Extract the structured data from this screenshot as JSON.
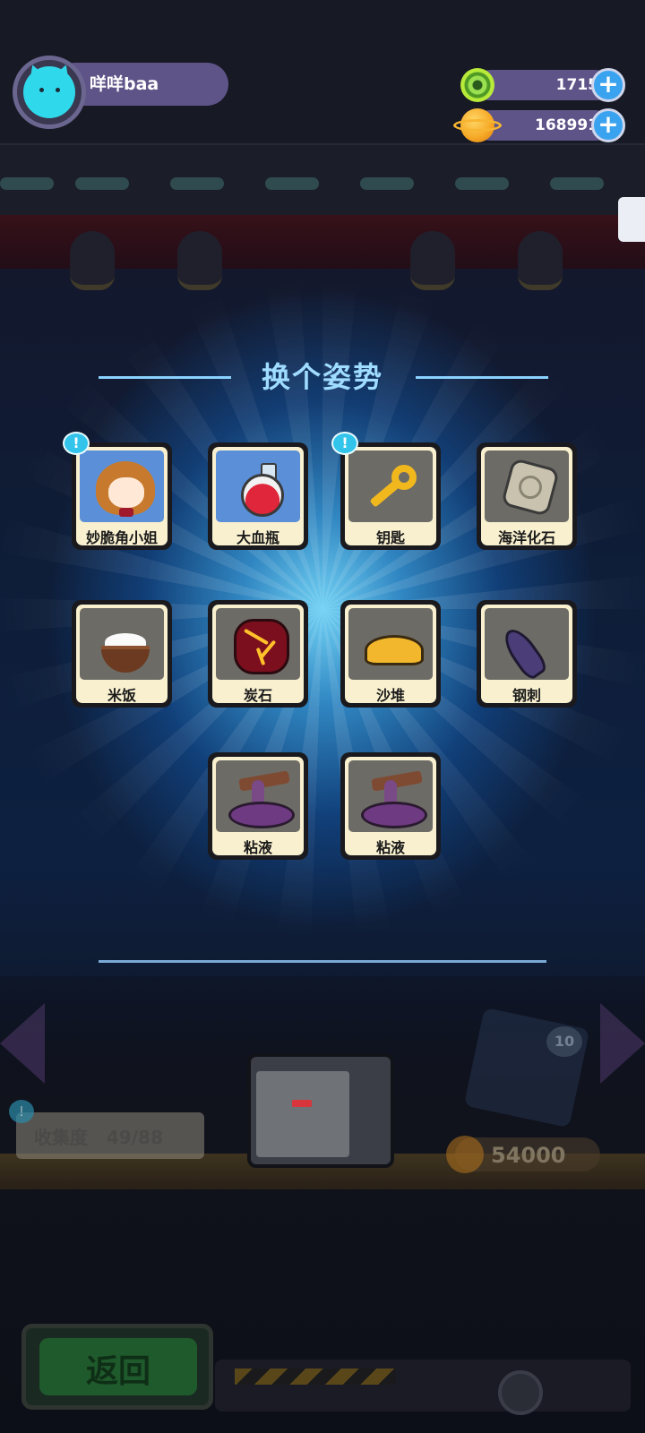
{
  "player": {
    "name": "咩咩baa",
    "avatar_icon": "cat-avatar-icon"
  },
  "currencies": [
    {
      "name": "gem",
      "value": "1715",
      "icon": "green-gem-icon"
    },
    {
      "name": "coin",
      "value": "168991",
      "icon": "planet-coin-icon"
    }
  ],
  "dialog": {
    "title": "换个姿势",
    "items": [
      {
        "label": "妙脆角小姐",
        "icon": "girl-character-icon",
        "badge": "!"
      },
      {
        "label": "大血瓶",
        "icon": "red-potion-icon"
      },
      {
        "label": "钥匙",
        "icon": "key-icon",
        "badge": "!"
      },
      {
        "label": "海洋化石",
        "icon": "fossil-icon"
      },
      {
        "label": "米饭",
        "icon": "rice-bowl-icon"
      },
      {
        "label": "炭石",
        "icon": "coal-stone-icon"
      },
      {
        "label": "沙堆",
        "icon": "sand-pile-icon"
      },
      {
        "label": "钢刺",
        "icon": "steel-spike-icon"
      },
      {
        "label": "粘液",
        "icon": "slime-icon"
      },
      {
        "label": "粘液",
        "icon": "slime-icon"
      }
    ]
  },
  "background": {
    "collection_label": "收集度",
    "collection_value": "49/88",
    "box_badge": "10",
    "price": "54000",
    "back_label": "返回",
    "badge_mark": "!"
  },
  "colors": {
    "title": "#9fdcff",
    "card_bg": "#f8f0cf",
    "accent_blue": "#3aa3ef"
  }
}
